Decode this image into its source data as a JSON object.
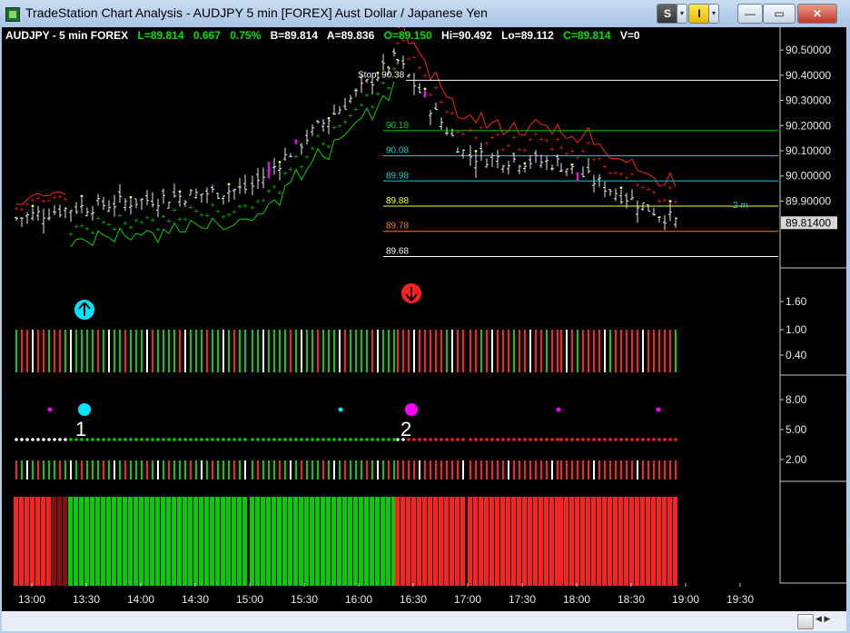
{
  "window": {
    "title": "TradeStation Chart Analysis - AUDJPY 5 min [FOREX] Aust Dollar / Japanese Yen",
    "buttons": {
      "s_label": "S",
      "i_label": "I",
      "dropdown": "▾",
      "minimize": "—",
      "maximize": "▭",
      "close": "✕"
    }
  },
  "infobar": {
    "symbol": "AUDJPY - 5 min  FOREX",
    "last": "L=89.814",
    "change": "0.667",
    "change_pct": "0.75%",
    "bid": "B=89.814",
    "ask": "A=89.836",
    "open": "O=89.150",
    "high": "Hi=90.492",
    "low": "Lo=89.112",
    "close": "C=89.814",
    "volume": "V=0"
  },
  "colors": {
    "background": "#000000",
    "up": "#00d000",
    "down": "#ff2020",
    "neutral": "#ffffff",
    "magenta": "#ff00ff",
    "cyan": "#00e5ff",
    "dark_red": "#8a0f0f"
  },
  "price_axis": {
    "ticks": [
      "90.50000",
      "90.40000",
      "90.30000",
      "90.20000",
      "90.10000",
      "90.00000",
      "89.90000"
    ],
    "current_price_label": "89.81400"
  },
  "horizontal_levels": [
    {
      "label": "Stop: 90.38",
      "value": 90.38,
      "color": "#ffffff"
    },
    {
      "label": "90.18",
      "value": 90.18,
      "color": "#00d000"
    },
    {
      "label": "90.08",
      "value": 90.08,
      "color": "#00d0d0"
    },
    {
      "label": "89.98",
      "value": 89.98,
      "color": "#00d0d0"
    },
    {
      "label": "89.88",
      "value": 89.88,
      "color": "#ffff40"
    },
    {
      "label": "89.78",
      "value": 89.78,
      "color": "#ff8000"
    },
    {
      "label": "89.68",
      "value": 89.68,
      "color": "#ffffff"
    }
  ],
  "target_label": "2 m",
  "indicator_axes": {
    "panel1": [
      "1.60",
      "1.00",
      "0.40"
    ],
    "panel2": [
      "8.00",
      "5.00",
      "2.00"
    ]
  },
  "signals": {
    "buy_arrow": "up-arrow-icon",
    "sell_arrow": "down-arrow-icon",
    "label_1": "1",
    "label_2": "2"
  },
  "time_axis": [
    "13:00",
    "13:30",
    "14:00",
    "14:30",
    "15:00",
    "15:30",
    "16:00",
    "16:30",
    "17:00",
    "17:30",
    "18:00",
    "18:30",
    "19:00",
    "19:30"
  ],
  "chart_data": {
    "type": "candlestick",
    "interval": "5 min",
    "bar_count": 123,
    "phases": [
      {
        "start_time": "12:50",
        "end_time": "13:20",
        "price_start": 89.83,
        "price_end": 89.87
      },
      {
        "start_time": "13:20",
        "end_time": "15:00",
        "price_start": 89.87,
        "price_end": 89.95
      },
      {
        "start_time": "15:00",
        "end_time": "16:20",
        "price_start": 89.95,
        "price_end": 90.47
      },
      {
        "start_time": "16:20",
        "end_time": "17:00",
        "price_start": 90.47,
        "price_end": 90.08
      },
      {
        "start_time": "17:00",
        "end_time": "17:50",
        "price_start": 90.08,
        "price_end": 90.05
      },
      {
        "start_time": "17:50",
        "end_time": "18:55",
        "price_start": 90.05,
        "price_end": 89.814
      }
    ],
    "ylim": [
      89.66,
      90.54
    ]
  }
}
